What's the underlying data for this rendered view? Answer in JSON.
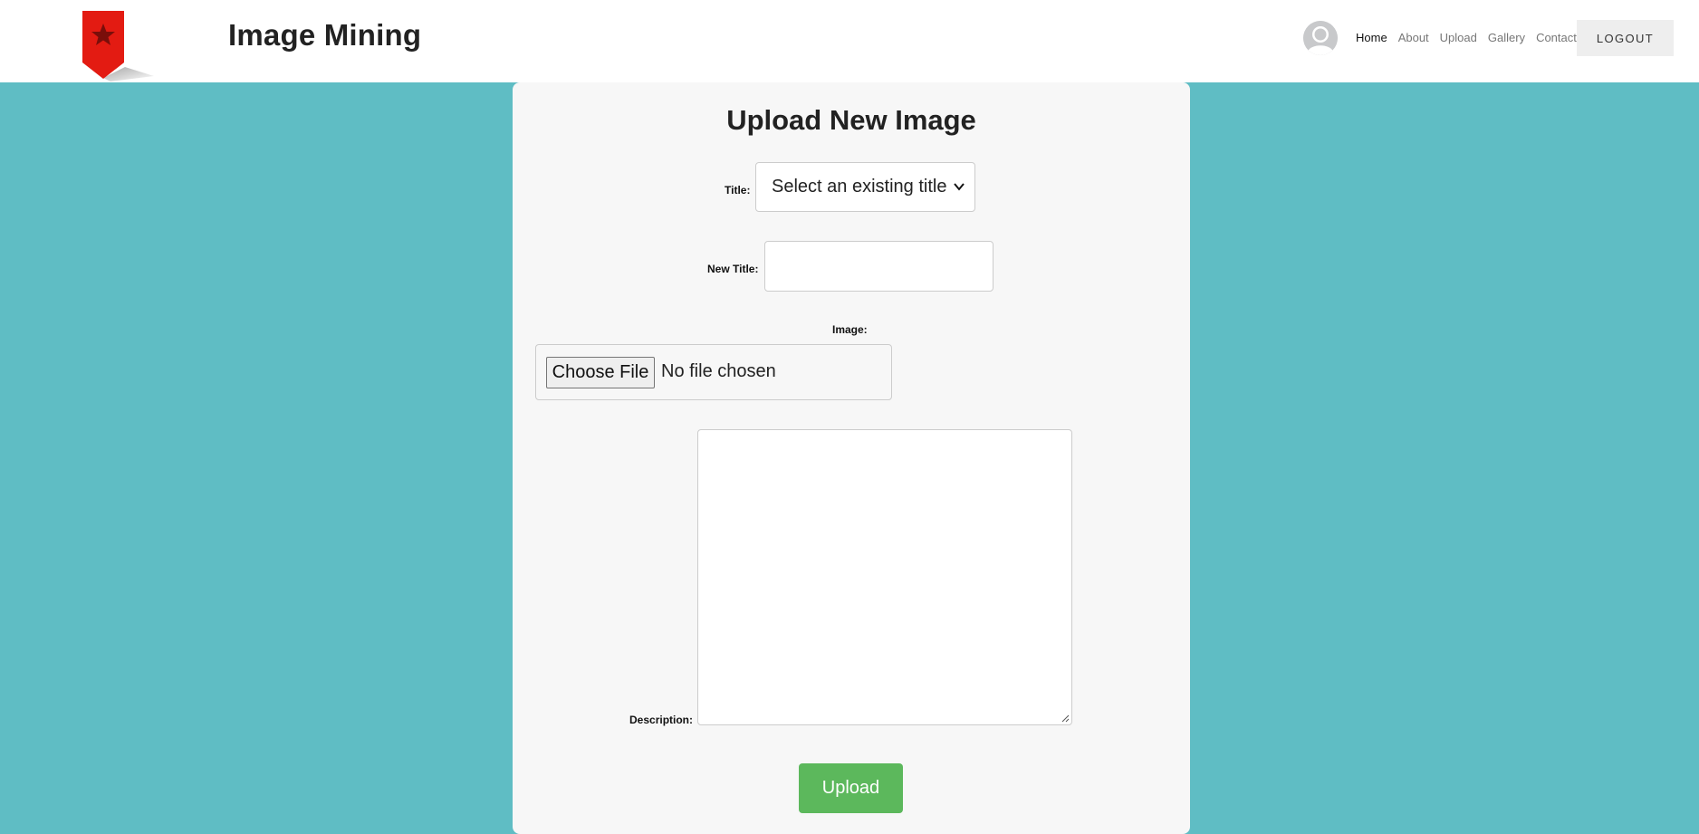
{
  "brand": {
    "title": "Image Mining"
  },
  "nav": {
    "items": [
      "Home",
      "About",
      "Upload",
      "Gallery",
      "Contact"
    ],
    "logout_label": "LOGOUT"
  },
  "form": {
    "heading": "Upload New Image",
    "title_label": "Title:",
    "title_select_value": "Select an existing title",
    "new_title_label": "New Title:",
    "new_title_value": "",
    "image_label": "Image:",
    "choose_file_label": "Choose File",
    "file_status": "No file chosen",
    "description_label": "Description:",
    "description_value": "",
    "submit_label": "Upload"
  },
  "colors": {
    "page_background": "#5fbdc4",
    "card_background": "#f7f7f7",
    "upload_button": "#5cb85c",
    "logo_red": "#e31b12"
  }
}
